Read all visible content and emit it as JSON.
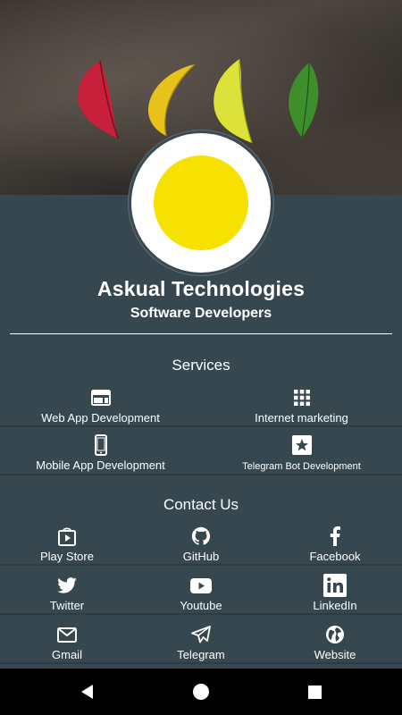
{
  "header": {
    "company_name": "Askual Technologies",
    "tagline": "Software Developers"
  },
  "services": {
    "title": "Services",
    "items": [
      {
        "label": "Web App Development",
        "icon": "web-icon"
      },
      {
        "label": "Internet marketing",
        "icon": "apps-grid-icon"
      },
      {
        "label": "Mobile App Development",
        "icon": "smartphone-icon"
      },
      {
        "label": "Telegram Bot Development",
        "icon": "star-box-icon"
      }
    ]
  },
  "contact": {
    "title": "Contact Us",
    "items": [
      {
        "label": "Play Store",
        "icon": "play-store-icon"
      },
      {
        "label": "GitHub",
        "icon": "github-icon"
      },
      {
        "label": "Facebook",
        "icon": "facebook-icon"
      },
      {
        "label": "Twitter",
        "icon": "twitter-icon"
      },
      {
        "label": "Youtube",
        "icon": "youtube-icon"
      },
      {
        "label": "LinkedIn",
        "icon": "linkedin-icon"
      },
      {
        "label": "Gmail",
        "icon": "gmail-icon"
      },
      {
        "label": "Telegram",
        "icon": "telegram-icon"
      },
      {
        "label": "Website",
        "icon": "globe-icon"
      }
    ]
  },
  "colors": {
    "background": "#37474f",
    "logo_fill": "#f7e100",
    "nav_bar": "#000000"
  }
}
